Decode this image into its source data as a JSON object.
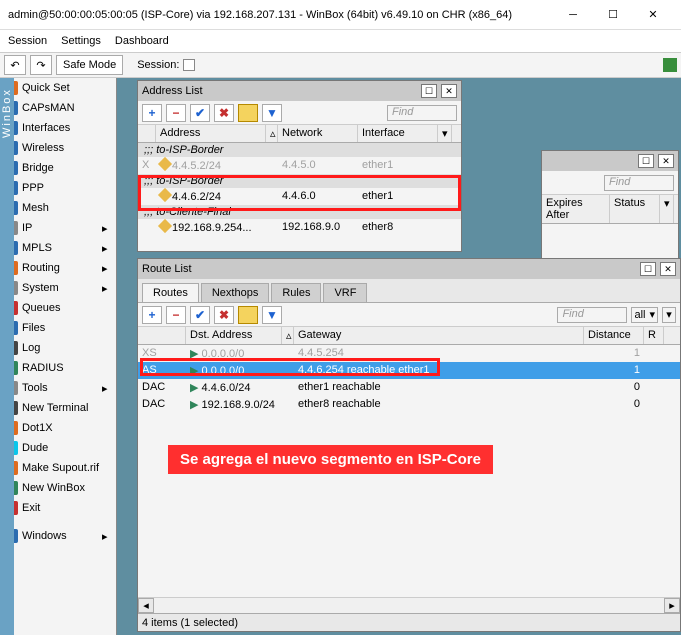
{
  "title": "admin@50:00:00:05:00:05 (ISP-Core) via 192.168.207.131 - WinBox (64bit) v6.49.10 on CHR (x86_64)",
  "menu": [
    "Session",
    "Settings",
    "Dashboard"
  ],
  "toolbar": {
    "safe_mode": "Safe Mode",
    "session_label": "Session:"
  },
  "side_tab": "WinBox",
  "sidebar": [
    {
      "label": "Quick Set",
      "ic": "ic-orange",
      "sub": false
    },
    {
      "label": "CAPsMAN",
      "ic": "ic-blue",
      "sub": false
    },
    {
      "label": "Interfaces",
      "ic": "ic-blue",
      "sub": false
    },
    {
      "label": "Wireless",
      "ic": "ic-blue",
      "sub": false
    },
    {
      "label": "Bridge",
      "ic": "ic-blue",
      "sub": false
    },
    {
      "label": "PPP",
      "ic": "ic-blue",
      "sub": false
    },
    {
      "label": "Mesh",
      "ic": "ic-blue",
      "sub": false
    },
    {
      "label": "IP",
      "ic": "ic-gray",
      "sub": true
    },
    {
      "label": "MPLS",
      "ic": "ic-blue",
      "sub": true
    },
    {
      "label": "Routing",
      "ic": "ic-orange",
      "sub": true
    },
    {
      "label": "System",
      "ic": "ic-gray",
      "sub": true
    },
    {
      "label": "Queues",
      "ic": "ic-red",
      "sub": false
    },
    {
      "label": "Files",
      "ic": "ic-blue",
      "sub": false
    },
    {
      "label": "Log",
      "ic": "ic-dark",
      "sub": false
    },
    {
      "label": "RADIUS",
      "ic": "ic-green",
      "sub": false
    },
    {
      "label": "Tools",
      "ic": "ic-gray",
      "sub": true
    },
    {
      "label": "New Terminal",
      "ic": "ic-dark",
      "sub": false
    },
    {
      "label": "Dot1X",
      "ic": "ic-orange",
      "sub": false
    },
    {
      "label": "Dude",
      "ic": "ic-cyan",
      "sub": false
    },
    {
      "label": "Make Supout.rif",
      "ic": "ic-orange",
      "sub": false
    },
    {
      "label": "New WinBox",
      "ic": "ic-green",
      "sub": false
    },
    {
      "label": "Exit",
      "ic": "ic-red",
      "sub": false
    },
    {
      "label": "",
      "ic": "",
      "sub": false,
      "sep": true
    },
    {
      "label": "Windows",
      "ic": "ic-blue",
      "sub": true
    }
  ],
  "addr_win": {
    "title": "Address List",
    "find_placeholder": "Find",
    "headers": [
      "Address",
      "Network",
      "Interface"
    ],
    "groups": [
      {
        "name": ";;; to-ISP-Border",
        "rows": [
          {
            "flag": "X",
            "addr": "4.4.5.2/24",
            "net": "4.4.5.0",
            "iface": "ether1",
            "disabled": true
          }
        ]
      },
      {
        "name": ";;; to-ISP-Border",
        "rows": [
          {
            "flag": "",
            "addr": "4.4.6.2/24",
            "net": "4.4.6.0",
            "iface": "ether1",
            "disabled": false
          }
        ]
      },
      {
        "name": ";;; to-Cliente-Final",
        "rows": [
          {
            "flag": "",
            "addr": "192.168.9.254...",
            "net": "192.168.9.0",
            "iface": "ether8",
            "disabled": false
          }
        ]
      }
    ]
  },
  "bg_win": {
    "headers": [
      "Expires After",
      "Status"
    ],
    "find_placeholder": "Find"
  },
  "route_win": {
    "title": "Route List",
    "tabs": [
      "Routes",
      "Nexthops",
      "Rules",
      "VRF"
    ],
    "active_tab": 0,
    "find_placeholder": "Find",
    "all_label": "all",
    "headers": [
      "",
      "Dst. Address",
      "Gateway",
      "Distance",
      "R"
    ],
    "rows": [
      {
        "flags": "XS",
        "addr": "0.0.0.0/0",
        "gw": "4.4.5.254",
        "dist": "1",
        "r": "",
        "disabled": true
      },
      {
        "flags": "AS",
        "addr": "0.0.0.0/0",
        "gw": "4.4.6.254 reachable ether1",
        "dist": "1",
        "r": "",
        "sel": true
      },
      {
        "flags": "DAC",
        "addr": "4.4.6.0/24",
        "gw": "ether1 reachable",
        "dist": "0",
        "r": ""
      },
      {
        "flags": "DAC",
        "addr": "192.168.9.0/24",
        "gw": "ether8 reachable",
        "dist": "0",
        "r": ""
      }
    ],
    "status": "4 items (1 selected)"
  },
  "annotation": "Se agrega el nuevo segmento en ISP-Core"
}
